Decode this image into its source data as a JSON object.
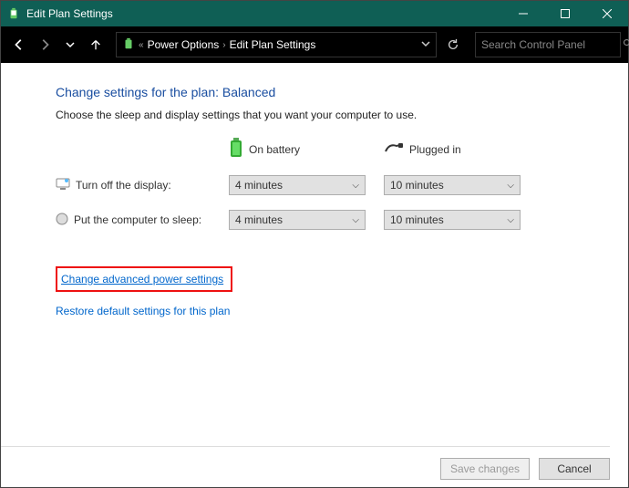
{
  "window": {
    "title": "Edit Plan Settings"
  },
  "breadcrumb": {
    "item1": "Power Options",
    "item2": "Edit Plan Settings"
  },
  "search": {
    "placeholder": "Search Control Panel"
  },
  "page": {
    "heading": "Change settings for the plan: Balanced",
    "description": "Choose the sleep and display settings that you want your computer to use."
  },
  "columns": {
    "battery": "On battery",
    "plugged": "Plugged in"
  },
  "rows": {
    "display": {
      "label": "Turn off the display:",
      "battery": "4 minutes",
      "plugged": "10 minutes"
    },
    "sleep": {
      "label": "Put the computer to sleep:",
      "battery": "4 minutes",
      "plugged": "10 minutes"
    }
  },
  "links": {
    "advanced": "Change advanced power settings",
    "restore": "Restore default settings for this plan"
  },
  "buttons": {
    "save": "Save changes",
    "cancel": "Cancel"
  }
}
